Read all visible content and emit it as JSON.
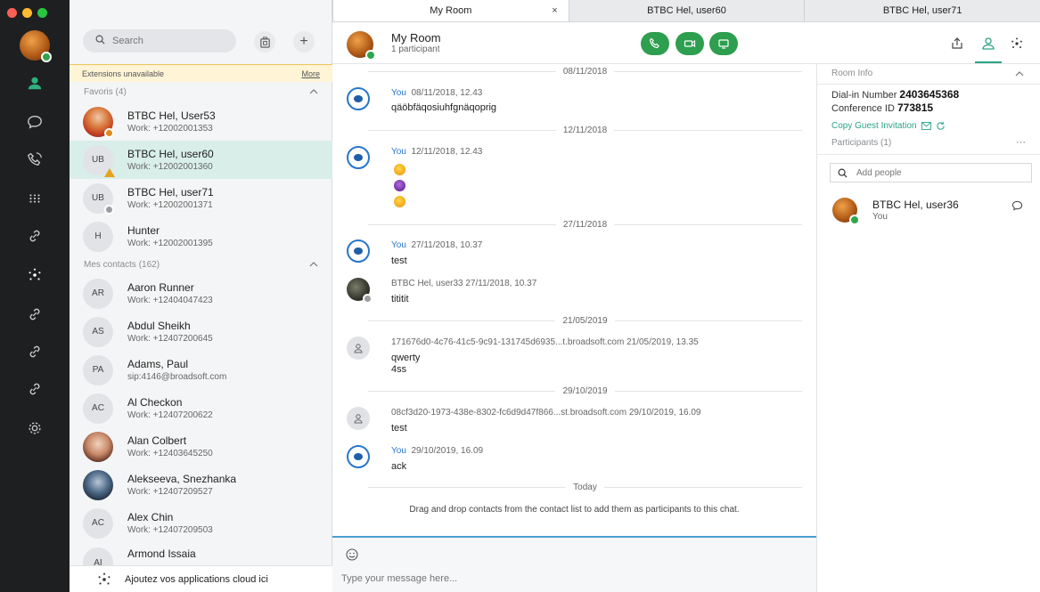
{
  "sidebar": {
    "search_placeholder": "Search",
    "warning_text": "Extensions unavailable",
    "warning_more": "More",
    "favorites_label": "Favoris (4)",
    "contacts_label": "Mes contacts (162)",
    "favorites": [
      {
        "name": "BTBC Hel, User53",
        "sub": "Work: +12002001353",
        "initials": ""
      },
      {
        "name": "BTBC Hel, user60",
        "sub": "Work: +12002001360",
        "initials": "UB"
      },
      {
        "name": "BTBC Hel, user71",
        "sub": "Work: +12002001371",
        "initials": "UB"
      },
      {
        "name": "Hunter",
        "sub": "Work: +12002001395",
        "initials": "H"
      }
    ],
    "contacts": [
      {
        "name": "Aaron Runner",
        "sub": "Work: +12404047423",
        "initials": "AR"
      },
      {
        "name": "Abdul Sheikh",
        "sub": "Work: +12407200645",
        "initials": "AS"
      },
      {
        "name": "Adams, Paul",
        "sub": "sip:4146@broadsoft.com",
        "initials": "PA"
      },
      {
        "name": "Al Checkon",
        "sub": "Work: +12407200622",
        "initials": "AC"
      },
      {
        "name": "Alan Colbert",
        "sub": "Work: +12403645250",
        "initials": ""
      },
      {
        "name": "Alekseeva, Snezhanka",
        "sub": "Work: +12407209527",
        "initials": ""
      },
      {
        "name": "Alex Chin",
        "sub": "Work: +12407209503",
        "initials": "AC"
      },
      {
        "name": "Armond Issaia",
        "sub": "",
        "initials": "AI"
      }
    ],
    "cloud_label": "Ajoutez vos applications cloud ici"
  },
  "tabs": [
    {
      "label": "My Room",
      "close": "×"
    },
    {
      "label": "BTBC Hel, user60"
    },
    {
      "label": "BTBC Hel, user71"
    }
  ],
  "header": {
    "title": "My Room",
    "subtitle": "1 participant"
  },
  "messages": {
    "dates": [
      "08/11/2018",
      "12/11/2018",
      "27/11/2018",
      "21/05/2019",
      "29/10/2019",
      "Today"
    ],
    "you_label": "You",
    "m1_meta": "08/11/2018, 12.43",
    "m1_text": "qäöbfäqosiuhfgnäqoprig",
    "m2_meta": "12/11/2018, 12.43",
    "m3_meta": "27/11/2018, 10.37",
    "m3_text": "test",
    "m4_meta": "BTBC Hel, user33  27/11/2018, 10.37",
    "m4_text": "tititit",
    "m5_meta": "171676d0-4c76-41c5-9c91-131745d6935...t.broadsoft.com  21/05/2019, 13.35",
    "m5_text1": "qwerty",
    "m5_text2": "4ss",
    "m6_meta": "08cf3d20-1973-438e-8302-fc6d9d47f866...st.broadsoft.com  29/10/2019, 16.09",
    "m6_text": "test",
    "m7_meta": "29/10/2019, 16.09",
    "m7_text": "ack",
    "hint": "Drag and drop contacts from the contact list to add them as participants to this chat."
  },
  "composer": {
    "placeholder": "Type your message here..."
  },
  "room_info": {
    "title": "Room Info",
    "dialin_label": "Dial-in Number",
    "dialin_value": "2403645368",
    "conf_label": "Conference ID",
    "conf_value": "773815",
    "copy_label": "Copy Guest Invitation",
    "participants_label": "Participants (1)",
    "more": "···",
    "add_placeholder": "Add people",
    "participant_name": "BTBC Hel, user36",
    "participant_sub": "You"
  },
  "colors": {
    "accent_green": "#2e9e4f",
    "teal": "#2aa386",
    "you_blue": "#2876c9",
    "rail_bg": "#1e1f21"
  }
}
